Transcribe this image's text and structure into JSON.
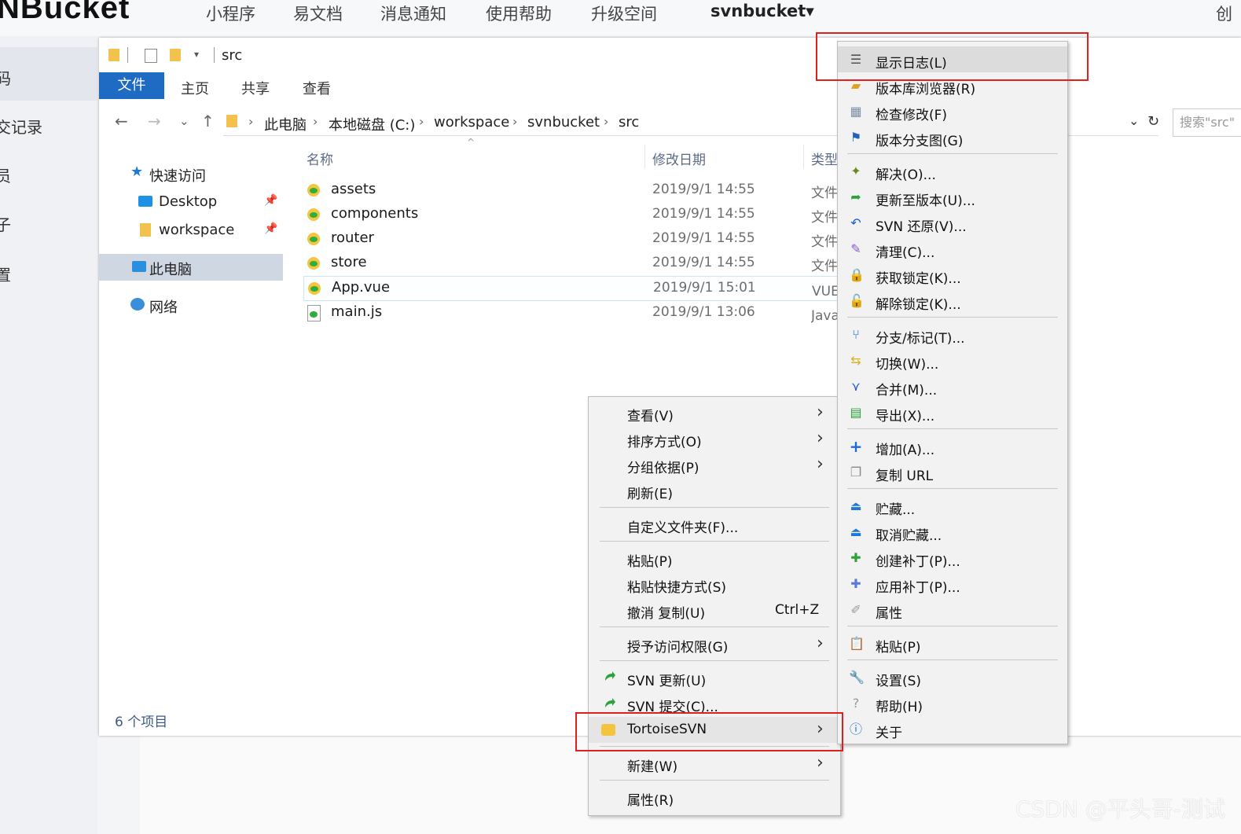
{
  "site": {
    "logo": "NBucket",
    "nav": [
      "小程序",
      "易文档",
      "消息通知",
      "使用帮助",
      "升级空间"
    ],
    "repo": "svnbucket▾",
    "nav_cut": "创",
    "side": [
      "码",
      "交记录",
      "员",
      "子",
      "置"
    ]
  },
  "explorer": {
    "title": "src",
    "tabs": {
      "file": "文件",
      "home": "主页",
      "share": "共享",
      "view": "查看"
    },
    "breadcrumb": [
      "此电脑",
      "本地磁盘 (C:)",
      "workspace",
      "svnbucket",
      "src"
    ],
    "search_placeholder": "搜索\"src\"",
    "nav": {
      "quick": "快速访问",
      "desktop": "Desktop",
      "workspace": "workspace",
      "pc": "此电脑",
      "network": "网络"
    },
    "columns": {
      "name": "名称",
      "date": "修改日期",
      "type": "类型"
    },
    "files": [
      {
        "name": "assets",
        "date": "2019/9/1 14:55",
        "type": "文件夹"
      },
      {
        "name": "components",
        "date": "2019/9/1 14:55",
        "type": "文件夹"
      },
      {
        "name": "router",
        "date": "2019/9/1 14:55",
        "type": "文件夹"
      },
      {
        "name": "store",
        "date": "2019/9/1 14:55",
        "type": "文件夹"
      },
      {
        "name": "App.vue",
        "date": "2019/9/1 15:01",
        "type": "VUE 文件"
      },
      {
        "name": "main.js",
        "date": "2019/9/1 13:06",
        "type": "JavaScript 文件"
      }
    ],
    "status": "6 个项目"
  },
  "context_menu": {
    "view": "查看(V)",
    "sort": "排序方式(O)",
    "group": "分组依据(P)",
    "refresh": "刷新(E)",
    "customize": "自定义文件夹(F)...",
    "paste": "粘贴(P)",
    "paste_shortcut": "粘贴快捷方式(S)",
    "undo": "撤消 复制(U)",
    "undo_shortcut": "Ctrl+Z",
    "grant": "授予访问权限(G)",
    "svn_update": "SVN 更新(U)",
    "svn_commit": "SVN 提交(C)...",
    "tortoise": "TortoiseSVN",
    "new": "新建(W)",
    "properties": "属性(R)"
  },
  "tortoise_menu": [
    "显示日志(L)",
    "版本库浏览器(R)",
    "检查修改(F)",
    "版本分支图(G)",
    "解决(O)...",
    "更新至版本(U)...",
    "SVN 还原(V)...",
    "清理(C)...",
    "获取锁定(K)...",
    "解除锁定(K)...",
    "分支/标记(T)...",
    "切换(W)...",
    "合并(M)...",
    "导出(X)...",
    "增加(A)...",
    "复制 URL",
    "贮藏...",
    "取消贮藏...",
    "创建补丁(P)...",
    "应用补丁(P)...",
    "属性",
    "粘贴(P)",
    "设置(S)",
    "帮助(H)",
    "关于"
  ],
  "watermark": "CSDN @平头哥-测试"
}
